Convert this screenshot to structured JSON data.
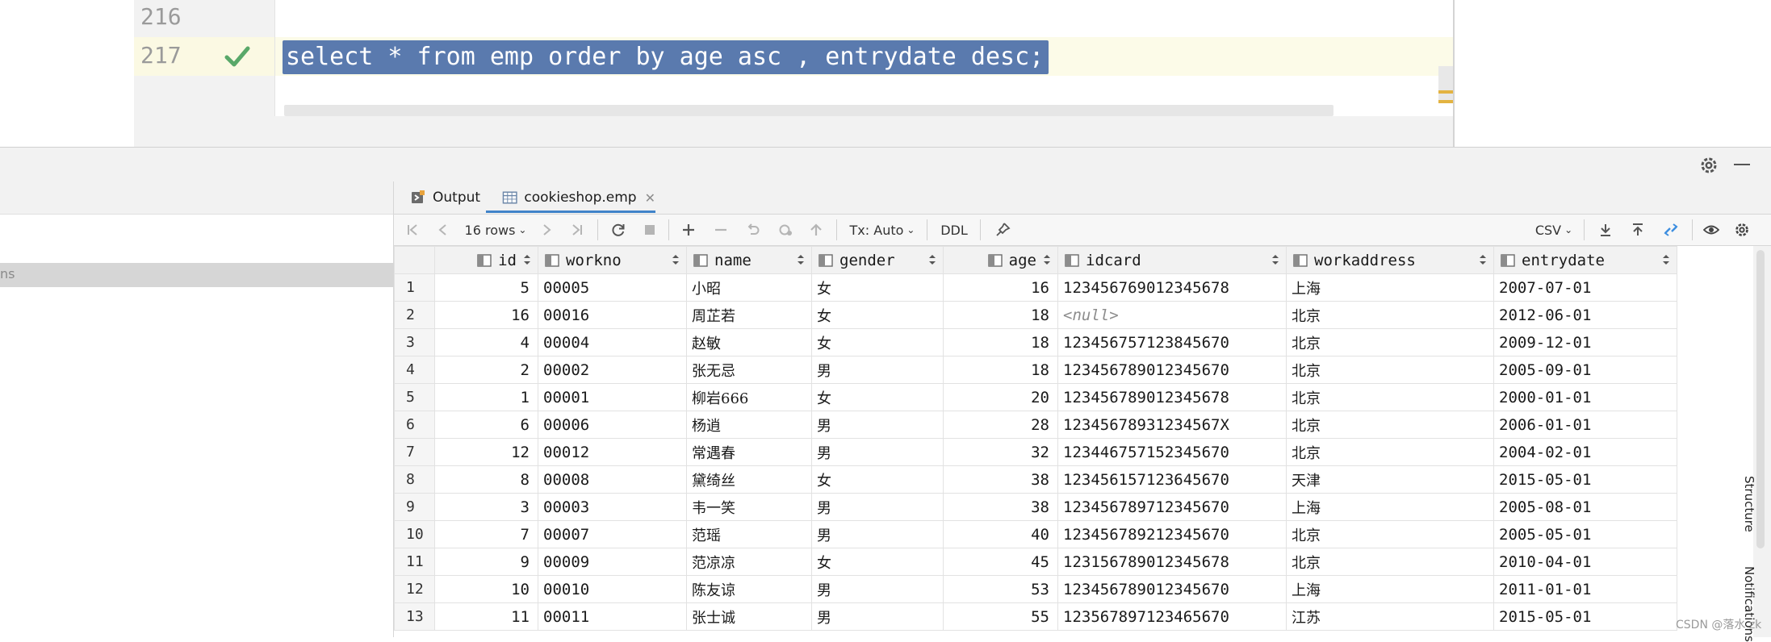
{
  "editor": {
    "lines": [
      {
        "number": "216"
      },
      {
        "number": "217",
        "status_icon": "check-icon"
      }
    ],
    "sql": "select * from emp order by age asc , entrydate desc;"
  },
  "services": {
    "left_selected_text": "ns",
    "tabs": [
      {
        "label": "Output",
        "icon": "output-icon"
      },
      {
        "label": "cookieshop.emp",
        "icon": "table-icon",
        "active": true
      }
    ],
    "toolbar": {
      "rows_label": "16 rows",
      "tx_label": "Tx: Auto",
      "ddl_label": "DDL",
      "export_format": "CSV"
    }
  },
  "grid": {
    "columns": [
      "id",
      "workno",
      "name",
      "gender",
      "age",
      "idcard",
      "workaddress",
      "entrydate"
    ],
    "rows": [
      {
        "n": "1",
        "id": "5",
        "workno": "00005",
        "name": "小昭",
        "gender": "女",
        "age": "16",
        "idcard": "123456769012345678",
        "workaddress": "上海",
        "entrydate": "2007-07-01"
      },
      {
        "n": "2",
        "id": "16",
        "workno": "00016",
        "name": "周芷若",
        "gender": "女",
        "age": "18",
        "idcard": "<null>",
        "workaddress": "北京",
        "entrydate": "2012-06-01"
      },
      {
        "n": "3",
        "id": "4",
        "workno": "00004",
        "name": "赵敏",
        "gender": "女",
        "age": "18",
        "idcard": "123456757123845670",
        "workaddress": "北京",
        "entrydate": "2009-12-01"
      },
      {
        "n": "4",
        "id": "2",
        "workno": "00002",
        "name": "张无忌",
        "gender": "男",
        "age": "18",
        "idcard": "123456789012345670",
        "workaddress": "北京",
        "entrydate": "2005-09-01"
      },
      {
        "n": "5",
        "id": "1",
        "workno": "00001",
        "name": "柳岩666",
        "gender": "女",
        "age": "20",
        "idcard": "123456789012345678",
        "workaddress": "北京",
        "entrydate": "2000-01-01"
      },
      {
        "n": "6",
        "id": "6",
        "workno": "00006",
        "name": "杨逍",
        "gender": "男",
        "age": "28",
        "idcard": "12345678931234567X",
        "workaddress": "北京",
        "entrydate": "2006-01-01"
      },
      {
        "n": "7",
        "id": "12",
        "workno": "00012",
        "name": "常遇春",
        "gender": "男",
        "age": "32",
        "idcard": "123446757152345670",
        "workaddress": "北京",
        "entrydate": "2004-02-01"
      },
      {
        "n": "8",
        "id": "8",
        "workno": "00008",
        "name": "黛绮丝",
        "gender": "女",
        "age": "38",
        "idcard": "123456157123645670",
        "workaddress": "天津",
        "entrydate": "2015-05-01"
      },
      {
        "n": "9",
        "id": "3",
        "workno": "00003",
        "name": "韦一笑",
        "gender": "男",
        "age": "38",
        "idcard": "123456789712345670",
        "workaddress": "上海",
        "entrydate": "2005-08-01"
      },
      {
        "n": "10",
        "id": "7",
        "workno": "00007",
        "name": "范瑶",
        "gender": "男",
        "age": "40",
        "idcard": "123456789212345670",
        "workaddress": "北京",
        "entrydate": "2005-05-01"
      },
      {
        "n": "11",
        "id": "9",
        "workno": "00009",
        "name": "范凉凉",
        "gender": "女",
        "age": "45",
        "idcard": "123156789012345678",
        "workaddress": "北京",
        "entrydate": "2010-04-01"
      },
      {
        "n": "12",
        "id": "10",
        "workno": "00010",
        "name": "陈友谅",
        "gender": "男",
        "age": "53",
        "idcard": "123456789012345670",
        "workaddress": "上海",
        "entrydate": "2011-01-01"
      },
      {
        "n": "13",
        "id": "11",
        "workno": "00011",
        "name": "张士诚",
        "gender": "男",
        "age": "55",
        "idcard": "123567897123465670",
        "workaddress": "江苏",
        "entrydate": "2015-05-01"
      }
    ]
  },
  "side_tabs": {
    "structure": "Structure",
    "notifications": "Notifications"
  },
  "watermark": "CSDN @落水 zk",
  "colors": {
    "selection": "#5a7aae",
    "caret_line": "#fcfbe8",
    "check": "#59a869",
    "tab_underline": "#4083c9",
    "toolbar_accent": "#3d8ee0"
  }
}
